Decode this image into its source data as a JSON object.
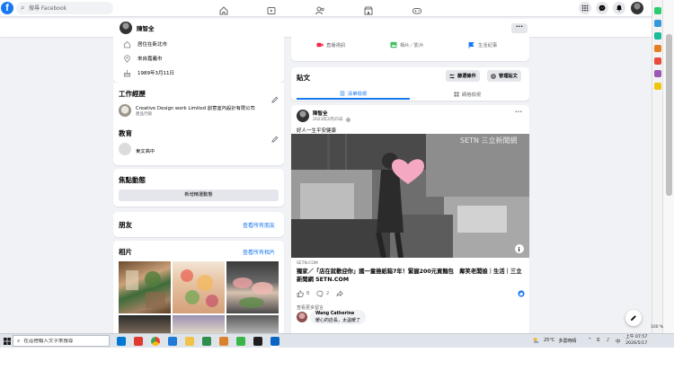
{
  "topnav": {
    "logo": "f",
    "search_placeholder": "搜尋 Facebook",
    "nav_icons": [
      "home-icon",
      "watch-icon",
      "friends-icon",
      "marketplace-icon",
      "gaming-icon"
    ],
    "right_icons": [
      "menu-grid-icon",
      "messenger-icon",
      "notifications-icon",
      "account-avatar"
    ]
  },
  "profilebar": {
    "name": "陳智全",
    "more_label": "···"
  },
  "intro": {
    "items": [
      {
        "icon": "home-icon",
        "text": "居住在新北市"
      },
      {
        "icon": "location-pin-icon",
        "text": "來自嘉義市"
      },
      {
        "icon": "birthday-cake-icon",
        "text": "1989年3月11日"
      }
    ]
  },
  "work": {
    "title": "工作經歷",
    "company": "Creative Design work Limited 創意室內設計有限公司",
    "role": "產品行銷"
  },
  "education": {
    "title": "教育",
    "school": "東文高中"
  },
  "featured": {
    "title": "焦點動態",
    "button": "新增精選動態"
  },
  "friends": {
    "title": "朋友",
    "see_all": "查看所有朋友"
  },
  "photos": {
    "title": "相片",
    "see_all": "查看所有相片"
  },
  "composer_actions": [
    {
      "icon": "live-video-icon",
      "label": "直播視訊",
      "color": "#f02849"
    },
    {
      "icon": "photo-video-icon",
      "label": "相片／影片",
      "color": "#45bd62"
    },
    {
      "icon": "life-event-icon",
      "label": "生活紀事",
      "color": "#1877f2"
    }
  ],
  "posts_section": {
    "title": "貼文",
    "filter_label": "篩選條件",
    "manage_label": "管理貼文",
    "tab_list": "清單檢視",
    "tab_grid": "網格檢視"
  },
  "post": {
    "author": "陳智全",
    "date": "2023年2月25日",
    "privacy_icon": "public-globe-icon",
    "text": "好人一生平安健康",
    "image_watermark": "SETN 三立新聞網",
    "link_domain": "SETN.COM",
    "link_title": "獨家／「店在就歡迎你」國一童撿紙箱7年！緊握200元買麵包　鄰笑老闆娘｜生活｜三立新聞網 SETN.COM",
    "like_count": "8",
    "comment_count": "2",
    "more_comments": "查看更多留言",
    "comment": {
      "author": "Wang Catherine",
      "text": "暖心的店長，太溫暖了"
    }
  },
  "browser": {
    "zoom": "100 %"
  },
  "taskbar": {
    "search_placeholder": "在這裡輸入文字來搜尋",
    "weather_temp": "25°C",
    "weather_desc": "多雲時晴",
    "ime": "中",
    "time": "上午 07:57",
    "date": "2026/5/17"
  },
  "colors": {
    "brand": "#1877f2",
    "page_bg": "#f0f2f5",
    "text_secondary": "#65676b"
  }
}
